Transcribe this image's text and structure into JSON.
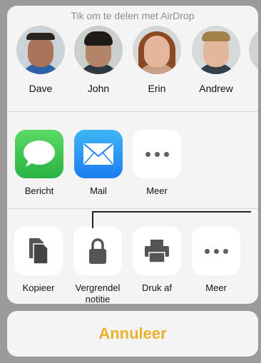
{
  "airdrop": {
    "title": "Tik om te delen met AirDrop",
    "people": [
      {
        "name": "Dave",
        "skin": "#a8745a",
        "hair": "#2a2420",
        "shirt": "#2e5fa8",
        "bg": "#c9d3d8"
      },
      {
        "name": "John",
        "skin": "#b48468",
        "hair": "#1e1a18",
        "shirt": "#2d3840",
        "bg": "#cbd0cc"
      },
      {
        "name": "Erin",
        "skin": "#e5b69c",
        "hair": "#8c4a24",
        "shirt": "#c7a088",
        "bg": "#d4d8d6"
      },
      {
        "name": "Andrew",
        "skin": "#e3b79b",
        "hair": "#a0824a",
        "shirt": "#36404a",
        "bg": "#d6dadb"
      }
    ]
  },
  "apps": [
    {
      "label": "Bericht",
      "icon": "speech-bubble-icon"
    },
    {
      "label": "Mail",
      "icon": "envelope-icon"
    },
    {
      "label": "Meer",
      "icon": "more-dots-icon"
    }
  ],
  "actions": [
    {
      "label": "Kopieer",
      "icon": "copy-icon"
    },
    {
      "label": "Vergrendel notitie",
      "icon": "lock-icon"
    },
    {
      "label": "Druk af",
      "icon": "printer-icon"
    },
    {
      "label": "Meer",
      "icon": "more-dots-icon"
    }
  ],
  "cancel": {
    "label": "Annuleer",
    "color": "#e8b32a"
  }
}
